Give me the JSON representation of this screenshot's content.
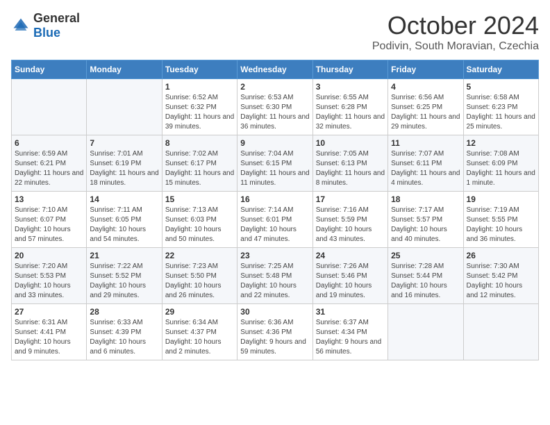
{
  "header": {
    "logo": {
      "general": "General",
      "blue": "Blue"
    },
    "title": "October 2024",
    "subtitle": "Podivin, South Moravian, Czechia"
  },
  "calendar": {
    "weekdays": [
      "Sunday",
      "Monday",
      "Tuesday",
      "Wednesday",
      "Thursday",
      "Friday",
      "Saturday"
    ],
    "weeks": [
      [
        {
          "day": "",
          "info": ""
        },
        {
          "day": "",
          "info": ""
        },
        {
          "day": "1",
          "info": "Sunrise: 6:52 AM\nSunset: 6:32 PM\nDaylight: 11 hours and 39 minutes."
        },
        {
          "day": "2",
          "info": "Sunrise: 6:53 AM\nSunset: 6:30 PM\nDaylight: 11 hours and 36 minutes."
        },
        {
          "day": "3",
          "info": "Sunrise: 6:55 AM\nSunset: 6:28 PM\nDaylight: 11 hours and 32 minutes."
        },
        {
          "day": "4",
          "info": "Sunrise: 6:56 AM\nSunset: 6:25 PM\nDaylight: 11 hours and 29 minutes."
        },
        {
          "day": "5",
          "info": "Sunrise: 6:58 AM\nSunset: 6:23 PM\nDaylight: 11 hours and 25 minutes."
        }
      ],
      [
        {
          "day": "6",
          "info": "Sunrise: 6:59 AM\nSunset: 6:21 PM\nDaylight: 11 hours and 22 minutes."
        },
        {
          "day": "7",
          "info": "Sunrise: 7:01 AM\nSunset: 6:19 PM\nDaylight: 11 hours and 18 minutes."
        },
        {
          "day": "8",
          "info": "Sunrise: 7:02 AM\nSunset: 6:17 PM\nDaylight: 11 hours and 15 minutes."
        },
        {
          "day": "9",
          "info": "Sunrise: 7:04 AM\nSunset: 6:15 PM\nDaylight: 11 hours and 11 minutes."
        },
        {
          "day": "10",
          "info": "Sunrise: 7:05 AM\nSunset: 6:13 PM\nDaylight: 11 hours and 8 minutes."
        },
        {
          "day": "11",
          "info": "Sunrise: 7:07 AM\nSunset: 6:11 PM\nDaylight: 11 hours and 4 minutes."
        },
        {
          "day": "12",
          "info": "Sunrise: 7:08 AM\nSunset: 6:09 PM\nDaylight: 11 hours and 1 minute."
        }
      ],
      [
        {
          "day": "13",
          "info": "Sunrise: 7:10 AM\nSunset: 6:07 PM\nDaylight: 10 hours and 57 minutes."
        },
        {
          "day": "14",
          "info": "Sunrise: 7:11 AM\nSunset: 6:05 PM\nDaylight: 10 hours and 54 minutes."
        },
        {
          "day": "15",
          "info": "Sunrise: 7:13 AM\nSunset: 6:03 PM\nDaylight: 10 hours and 50 minutes."
        },
        {
          "day": "16",
          "info": "Sunrise: 7:14 AM\nSunset: 6:01 PM\nDaylight: 10 hours and 47 minutes."
        },
        {
          "day": "17",
          "info": "Sunrise: 7:16 AM\nSunset: 5:59 PM\nDaylight: 10 hours and 43 minutes."
        },
        {
          "day": "18",
          "info": "Sunrise: 7:17 AM\nSunset: 5:57 PM\nDaylight: 10 hours and 40 minutes."
        },
        {
          "day": "19",
          "info": "Sunrise: 7:19 AM\nSunset: 5:55 PM\nDaylight: 10 hours and 36 minutes."
        }
      ],
      [
        {
          "day": "20",
          "info": "Sunrise: 7:20 AM\nSunset: 5:53 PM\nDaylight: 10 hours and 33 minutes."
        },
        {
          "day": "21",
          "info": "Sunrise: 7:22 AM\nSunset: 5:52 PM\nDaylight: 10 hours and 29 minutes."
        },
        {
          "day": "22",
          "info": "Sunrise: 7:23 AM\nSunset: 5:50 PM\nDaylight: 10 hours and 26 minutes."
        },
        {
          "day": "23",
          "info": "Sunrise: 7:25 AM\nSunset: 5:48 PM\nDaylight: 10 hours and 22 minutes."
        },
        {
          "day": "24",
          "info": "Sunrise: 7:26 AM\nSunset: 5:46 PM\nDaylight: 10 hours and 19 minutes."
        },
        {
          "day": "25",
          "info": "Sunrise: 7:28 AM\nSunset: 5:44 PM\nDaylight: 10 hours and 16 minutes."
        },
        {
          "day": "26",
          "info": "Sunrise: 7:30 AM\nSunset: 5:42 PM\nDaylight: 10 hours and 12 minutes."
        }
      ],
      [
        {
          "day": "27",
          "info": "Sunrise: 6:31 AM\nSunset: 4:41 PM\nDaylight: 10 hours and 9 minutes."
        },
        {
          "day": "28",
          "info": "Sunrise: 6:33 AM\nSunset: 4:39 PM\nDaylight: 10 hours and 6 minutes."
        },
        {
          "day": "29",
          "info": "Sunrise: 6:34 AM\nSunset: 4:37 PM\nDaylight: 10 hours and 2 minutes."
        },
        {
          "day": "30",
          "info": "Sunrise: 6:36 AM\nSunset: 4:36 PM\nDaylight: 9 hours and 59 minutes."
        },
        {
          "day": "31",
          "info": "Sunrise: 6:37 AM\nSunset: 4:34 PM\nDaylight: 9 hours and 56 minutes."
        },
        {
          "day": "",
          "info": ""
        },
        {
          "day": "",
          "info": ""
        }
      ]
    ]
  }
}
